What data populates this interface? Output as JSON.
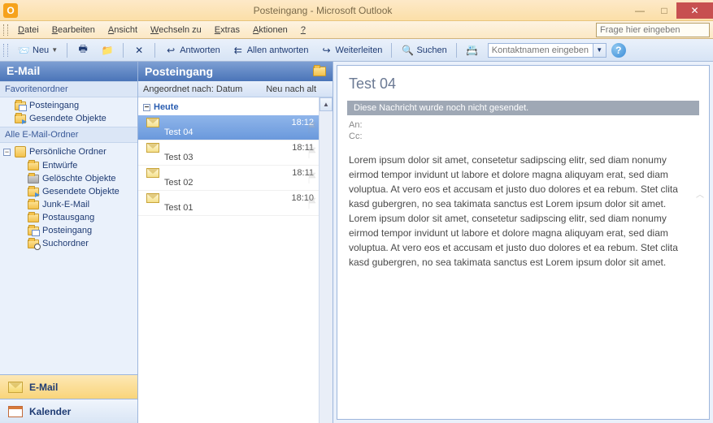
{
  "window": {
    "title": "Posteingang - Microsoft Outlook",
    "app_icon_letter": "O"
  },
  "menubar": {
    "items": [
      "Datei",
      "Bearbeiten",
      "Ansicht",
      "Wechseln zu",
      "Extras",
      "Aktionen",
      "?"
    ],
    "help_placeholder": "Frage hier eingeben"
  },
  "toolbar": {
    "new_label": "Neu",
    "reply_label": "Antworten",
    "reply_all_label": "Allen antworten",
    "forward_label": "Weiterleiten",
    "search_label": "Suchen",
    "contact_placeholder": "Kontaktnamen eingeben"
  },
  "nav": {
    "header": "E-Mail",
    "fav_label": "Favoritenordner",
    "fav_items": [
      {
        "label": "Posteingang",
        "kind": "inbox"
      },
      {
        "label": "Gesendete Objekte",
        "kind": "sent"
      }
    ],
    "all_label": "Alle E-Mail-Ordner",
    "root_label": "Persönliche Ordner",
    "root_children": [
      {
        "label": "Entwürfe",
        "kind": "plain"
      },
      {
        "label": "Gelöschte Objekte",
        "kind": "trash"
      },
      {
        "label": "Gesendete Objekte",
        "kind": "sent"
      },
      {
        "label": "Junk-E-Mail",
        "kind": "plain"
      },
      {
        "label": "Postausgang",
        "kind": "plain"
      },
      {
        "label": "Posteingang",
        "kind": "inbox"
      },
      {
        "label": "Suchordner",
        "kind": "search"
      }
    ],
    "buttons": {
      "mail": "E-Mail",
      "calendar": "Kalender"
    }
  },
  "msglist": {
    "header": "Posteingang",
    "arrange_by": "Angeordnet nach: Datum",
    "sort_label": "Neu nach alt",
    "group_label": "Heute",
    "items": [
      {
        "subject": "Test 04",
        "time": "18:12",
        "selected": true
      },
      {
        "subject": "Test 03",
        "time": "18:11",
        "selected": false
      },
      {
        "subject": "Test 02",
        "time": "18:11",
        "selected": false
      },
      {
        "subject": "Test 01",
        "time": "18:10",
        "selected": false
      }
    ]
  },
  "reading": {
    "subject": "Test 04",
    "notice": "Diese Nachricht wurde noch nicht gesendet.",
    "to_label": "An:",
    "cc_label": "Cc:",
    "body": "Lorem ipsum dolor sit amet, consetetur sadipscing elitr, sed diam nonumy eirmod tempor invidunt ut labore et dolore magna aliquyam erat, sed diam voluptua. At vero eos et accusam et justo duo dolores et ea rebum. Stet clita kasd gubergren, no sea takimata sanctus est Lorem ipsum dolor sit amet. Lorem ipsum dolor sit amet, consetetur sadipscing elitr, sed diam nonumy eirmod tempor invidunt ut labore et dolore magna aliquyam erat, sed diam voluptua. At vero eos et accusam et justo duo dolores et ea rebum. Stet clita kasd gubergren, no sea takimata sanctus est Lorem ipsum dolor sit amet."
  }
}
